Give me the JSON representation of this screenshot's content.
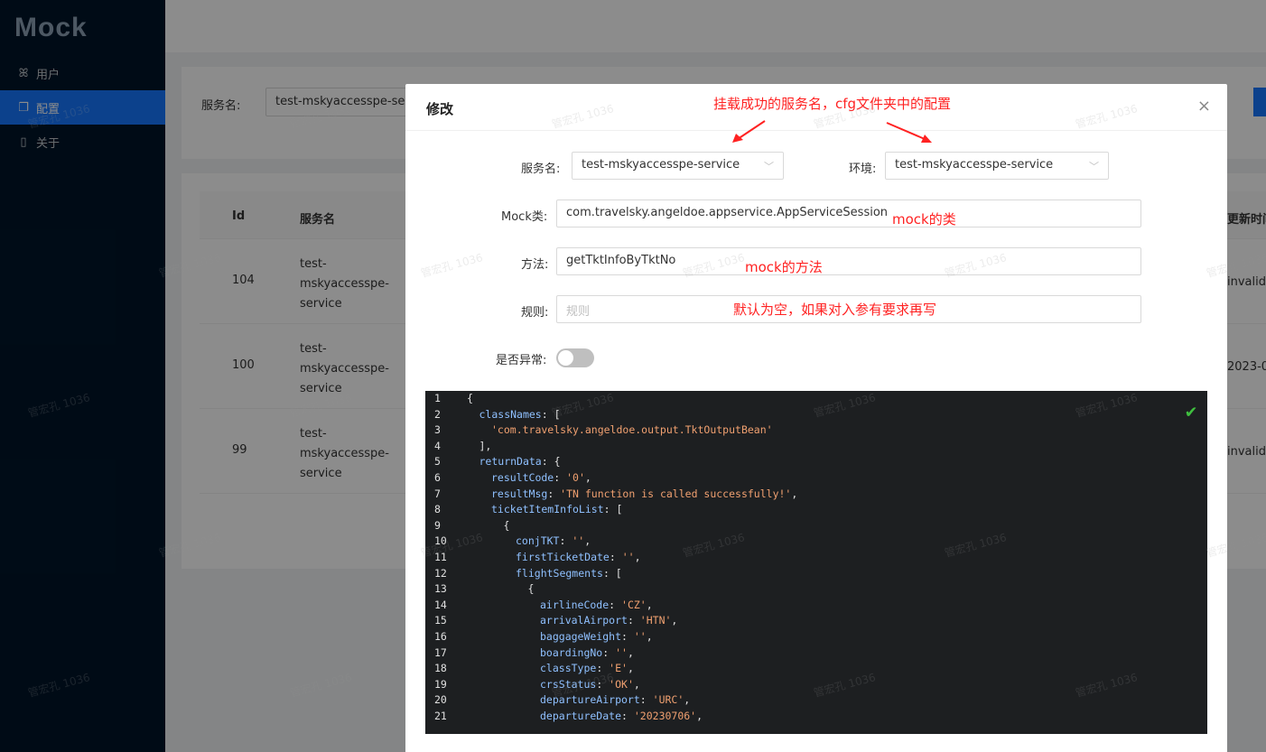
{
  "app": {
    "logo": "Mock"
  },
  "sidebar": {
    "items": [
      {
        "label": "用户",
        "icon": "user-icon",
        "active": false
      },
      {
        "label": "配置",
        "icon": "file-copy-icon",
        "active": true
      },
      {
        "label": "关于",
        "icon": "file-icon",
        "active": false
      }
    ]
  },
  "filter": {
    "label": "服务名:",
    "value": "test-mskyaccesspe-service"
  },
  "table": {
    "columns": [
      "Id",
      "服务名"
    ],
    "rows": [
      {
        "id": "104",
        "name": "test-\nmskyaccesspe-\nservice",
        "right": "invalid d"
      },
      {
        "id": "100",
        "name": "test-\nmskyaccesspe-\nservice",
        "right": "2023-0"
      },
      {
        "id": "99",
        "name": "test-\nmskyaccesspe-\nservice",
        "right": "invalid d"
      }
    ],
    "right_header": "更新时间"
  },
  "modal": {
    "title": "修改",
    "close": "×",
    "service_label": "服务名:",
    "service_value": "test-mskyaccesspe-service",
    "env_label": "环境:",
    "env_value": "test-mskyaccesspe-service",
    "mock_class_label": "Mock类:",
    "mock_class_value": "com.travelsky.angeldoe.appservice.AppServiceSession",
    "method_label": "方法:",
    "method_value": "getTktInfoByTktNo",
    "rule_label": "规则:",
    "rule_placeholder": "规则",
    "exception_label": "是否异常:",
    "exception_on": false
  },
  "annotations": {
    "service_note": "挂载成功的服务名，cfg文件夹中的配置",
    "class_note": "mock的类",
    "method_note": "mock的方法",
    "rule_note": "默认为空，如果对入参有要求再写"
  },
  "code_lines": [
    {
      "n": "1",
      "indent": 0,
      "parts": [
        [
          "p",
          "{"
        ]
      ]
    },
    {
      "n": "2",
      "indent": 1,
      "parts": [
        [
          "k",
          "classNames"
        ],
        [
          "p",
          ": ["
        ]
      ]
    },
    {
      "n": "3",
      "indent": 2,
      "parts": [
        [
          "s",
          "'com.travelsky.angeldoe.output.TktOutputBean'"
        ]
      ]
    },
    {
      "n": "4",
      "indent": 1,
      "parts": [
        [
          "p",
          "],"
        ]
      ]
    },
    {
      "n": "5",
      "indent": 1,
      "parts": [
        [
          "k",
          "returnData"
        ],
        [
          "p",
          ": {"
        ]
      ]
    },
    {
      "n": "6",
      "indent": 2,
      "parts": [
        [
          "k",
          "resultCode"
        ],
        [
          "p",
          ": "
        ],
        [
          "s",
          "'0'"
        ],
        [
          "p",
          ","
        ]
      ]
    },
    {
      "n": "7",
      "indent": 2,
      "parts": [
        [
          "k",
          "resultMsg"
        ],
        [
          "p",
          ": "
        ],
        [
          "s",
          "'TN function is called successfully!'"
        ],
        [
          "p",
          ","
        ]
      ]
    },
    {
      "n": "8",
      "indent": 2,
      "parts": [
        [
          "k",
          "ticketItemInfoList"
        ],
        [
          "p",
          ": ["
        ]
      ]
    },
    {
      "n": "9",
      "indent": 3,
      "parts": [
        [
          "p",
          "{"
        ]
      ]
    },
    {
      "n": "10",
      "indent": 4,
      "parts": [
        [
          "k",
          "conjTKT"
        ],
        [
          "p",
          ": "
        ],
        [
          "s",
          "''"
        ],
        [
          "p",
          ","
        ]
      ]
    },
    {
      "n": "11",
      "indent": 4,
      "parts": [
        [
          "k",
          "firstTicketDate"
        ],
        [
          "p",
          ": "
        ],
        [
          "s",
          "''"
        ],
        [
          "p",
          ","
        ]
      ]
    },
    {
      "n": "12",
      "indent": 4,
      "parts": [
        [
          "k",
          "flightSegments"
        ],
        [
          "p",
          ": ["
        ]
      ]
    },
    {
      "n": "13",
      "indent": 5,
      "parts": [
        [
          "p",
          "{"
        ]
      ]
    },
    {
      "n": "14",
      "indent": 6,
      "parts": [
        [
          "k",
          "airlineCode"
        ],
        [
          "p",
          ": "
        ],
        [
          "s",
          "'CZ'"
        ],
        [
          "p",
          ","
        ]
      ]
    },
    {
      "n": "15",
      "indent": 6,
      "parts": [
        [
          "k",
          "arrivalAirport"
        ],
        [
          "p",
          ": "
        ],
        [
          "s",
          "'HTN'"
        ],
        [
          "p",
          ","
        ]
      ]
    },
    {
      "n": "16",
      "indent": 6,
      "parts": [
        [
          "k",
          "baggageWeight"
        ],
        [
          "p",
          ": "
        ],
        [
          "s",
          "''"
        ],
        [
          "p",
          ","
        ]
      ]
    },
    {
      "n": "17",
      "indent": 6,
      "parts": [
        [
          "k",
          "boardingNo"
        ],
        [
          "p",
          ": "
        ],
        [
          "s",
          "''"
        ],
        [
          "p",
          ","
        ]
      ]
    },
    {
      "n": "18",
      "indent": 6,
      "parts": [
        [
          "k",
          "classType"
        ],
        [
          "p",
          ": "
        ],
        [
          "s",
          "'E'"
        ],
        [
          "p",
          ","
        ]
      ]
    },
    {
      "n": "19",
      "indent": 6,
      "parts": [
        [
          "k",
          "crsStatus"
        ],
        [
          "p",
          ": "
        ],
        [
          "s",
          "'OK'"
        ],
        [
          "p",
          ","
        ]
      ]
    },
    {
      "n": "20",
      "indent": 6,
      "parts": [
        [
          "k",
          "departureAirport"
        ],
        [
          "p",
          ": "
        ],
        [
          "s",
          "'URC'"
        ],
        [
          "p",
          ","
        ]
      ]
    },
    {
      "n": "21",
      "indent": 6,
      "parts": [
        [
          "k",
          "departureDate"
        ],
        [
          "p",
          ": "
        ],
        [
          "s",
          "'20230706'"
        ],
        [
          "p",
          ","
        ]
      ]
    }
  ],
  "watermark": "管宏孔 1036",
  "colors": {
    "sidebar_bg": "#001529",
    "primary": "#1677ff",
    "annotation": "#ff2222",
    "editor_bg": "#1d1f21",
    "valid_check": "#3fbf3f"
  }
}
